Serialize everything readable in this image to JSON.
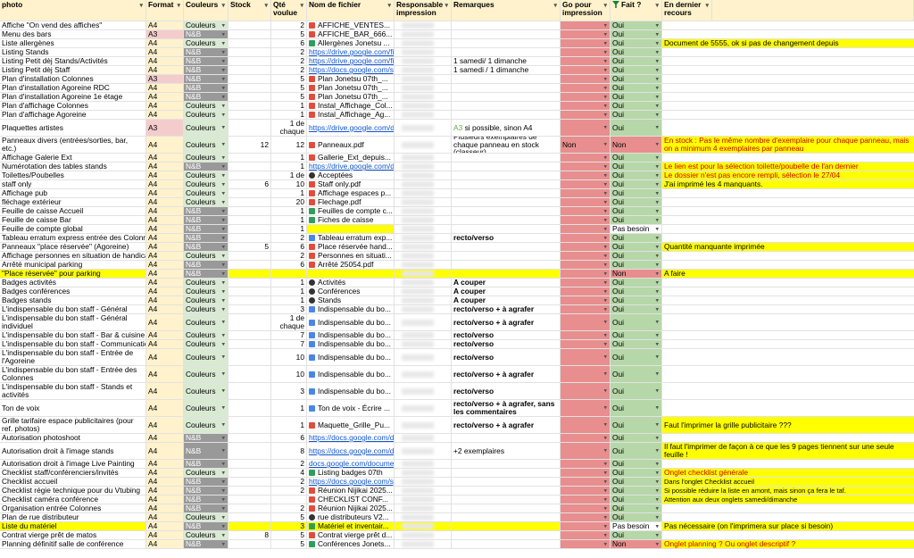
{
  "headers": [
    "photo",
    "Format",
    "Couleurs",
    "Stock",
    "Qté voulue",
    "Nom de fichier",
    "Responsable impression",
    "Remarques",
    "Go pour impression",
    "Fait ?",
    "En dernier recours",
    ""
  ],
  "colors": {
    "header": "#fff2cc",
    "format": "#fff2cc",
    "format_a3": "#f4cccc",
    "couleurs": "#d9ead3",
    "nb": "#999999",
    "go_red": "#e88e8e",
    "oui_green": "#b6d7a8",
    "non_red": "#e88e8e",
    "note_yellow": "#ffff00",
    "hilite_yellow": "#ffff00"
  },
  "rows": [
    {
      "photo": "Affiche \"On vend des affiches\"",
      "format": "A4",
      "couleurs": "Couleurs",
      "stock": "",
      "qte": "2",
      "file": "AFFICHE_VENTES...",
      "fileType": "pdf",
      "remark": "",
      "go": "",
      "fait": "Oui",
      "note": ""
    },
    {
      "photo": "Menu des bars",
      "format": "A3",
      "couleurs": "N&B",
      "stock": "",
      "qte": "5",
      "file": "AFFICHE_BAR_666...",
      "fileType": "pdf",
      "remark": "",
      "go": "",
      "fait": "Oui",
      "note": ""
    },
    {
      "photo": "Liste allergènes",
      "format": "A4",
      "couleurs": "Couleurs",
      "stock": "",
      "qte": "6",
      "file": "Allergènes Jonetsu ...",
      "fileType": "sheet",
      "remark": "",
      "go": "",
      "fait": "Oui",
      "note": "Document de 5555, ok si pas de changement depuis"
    },
    {
      "photo": "Listing Stands",
      "format": "A4",
      "couleurs": "N&B",
      "stock": "",
      "qte": "2",
      "file": "https://drive.google.com/file/d/",
      "fileType": "link",
      "remark": "",
      "go": "",
      "fait": "Oui",
      "note": ""
    },
    {
      "photo": "Listing Petit dèj Stands/Activités",
      "format": "A4",
      "couleurs": "N&B",
      "stock": "",
      "qte": "2",
      "file": "https://drive.google.com/file/d/",
      "fileType": "link",
      "remark": "1 samedi/ 1 dimanche",
      "go": "",
      "fait": "Oui",
      "note": ""
    },
    {
      "photo": "Listing Petit dèj Staff",
      "format": "A4",
      "couleurs": "N&B",
      "stock": "",
      "qte": "2",
      "file": "https://docs.google.com/spreads",
      "fileType": "link",
      "remark": "1 samedi / 1 dimanche",
      "go": "",
      "fait": "Oui",
      "note": ""
    },
    {
      "photo": "Plan d'installation Colonnes",
      "format": "A3",
      "couleurs": "N&B",
      "stock": "",
      "qte": "5",
      "file": "Plan Jonetsu 07th_...",
      "fileType": "pdf",
      "remark": "",
      "go": "",
      "fait": "Oui",
      "note": ""
    },
    {
      "photo": "Plan d'installation Agoreine RDC",
      "format": "A4",
      "couleurs": "N&B",
      "stock": "",
      "qte": "5",
      "file": "Plan Jonetsu 07th_...",
      "fileType": "pdf",
      "remark": "",
      "go": "",
      "fait": "Oui",
      "note": ""
    },
    {
      "photo": "Plan d'installation Agoreine 1e étage",
      "format": "A4",
      "couleurs": "N&B",
      "stock": "",
      "qte": "5",
      "file": "Plan Jonetsu 07th_...",
      "fileType": "pdf",
      "remark": "",
      "go": "",
      "fait": "Oui",
      "note": ""
    },
    {
      "photo": "Plan d'affichage Colonnes",
      "format": "A4",
      "couleurs": "Couleurs",
      "stock": "",
      "qte": "1",
      "file": "Instal_Affichage_Col...",
      "fileType": "pdf",
      "remark": "",
      "go": "",
      "fait": "Oui",
      "note": ""
    },
    {
      "photo": "Plan d'affichage Agoreine",
      "format": "A4",
      "couleurs": "Couleurs",
      "stock": "",
      "qte": "1",
      "file": "Instal_Affichage_Ag...",
      "fileType": "pdf",
      "remark": "",
      "go": "",
      "fait": "Oui",
      "note": ""
    },
    {
      "photo": "Plaquettes artistes",
      "format": "A3",
      "couleurs": "Couleurs",
      "stock": "",
      "qte": "1 de chaque",
      "file": "https://drive.google.com/drive/fo",
      "fileType": "link",
      "remark": "A3 si possible, sinon A4",
      "go": "",
      "fait": "Oui",
      "note": "",
      "tall": 2
    },
    {
      "photo": "Panneaux divers (entrées/sorties, bar, etc.)",
      "format": "A4",
      "couleurs": "Couleurs",
      "stock": "12",
      "qte": "12",
      "file": "Panneaux.pdf",
      "fileType": "pdf",
      "remark": "Plusieurs exemplaires de chaque panneau en stock (classeur)",
      "go": "Non",
      "fait": "Non",
      "note": "En stock : Pas le même nombre d'exemplaire pour chaque panneau, mais on a minimum 4 exemplaires par panneau",
      "tall": 2
    },
    {
      "photo": "Affichage Galerie Ext",
      "format": "A4",
      "couleurs": "Couleurs",
      "stock": "",
      "qte": "1",
      "file": "Gallerie_Ext_depuis...",
      "fileType": "pdf",
      "remark": "",
      "go": "",
      "fait": "Oui",
      "note": ""
    },
    {
      "photo": "Numérotation des tables stands",
      "format": "A4",
      "couleurs": "N&B",
      "stock": "",
      "qte": "1",
      "file": "https://drive.google.com/drive/fo",
      "fileType": "link",
      "remark": "",
      "go": "",
      "fait": "Oui",
      "note": "Le lien est pour la sélection toilette/poubelle de l'an dernier"
    },
    {
      "photo": "Toilettes/Poubelles",
      "format": "A4",
      "couleurs": "Couleurs",
      "stock": "",
      "qte": "1 de",
      "file": "Acceptées",
      "fileType": "img",
      "remark": "",
      "go": "",
      "fait": "Oui",
      "note": "Le dossier n'est pas encore rempli, sélection le 27/04"
    },
    {
      "photo": "staff only",
      "format": "A4",
      "couleurs": "Couleurs",
      "stock": "6",
      "qte": "10",
      "file": "Staff only.pdf",
      "fileType": "pdf",
      "remark": "",
      "go": "",
      "fait": "Oui",
      "note": "J'ai imprimé les 4 manquants."
    },
    {
      "photo": "Affichage pub",
      "format": "A4",
      "couleurs": "Couleurs",
      "stock": "",
      "qte": "1",
      "file": "Affichage espaces p...",
      "fileType": "pdf",
      "remark": "",
      "go": "",
      "fait": "Oui",
      "note": ""
    },
    {
      "photo": "fléchage extérieur",
      "format": "A4",
      "couleurs": "Couleurs",
      "stock": "",
      "qte": "20",
      "file": "Flechage.pdf",
      "fileType": "pdf",
      "remark": "",
      "go": "",
      "fait": "Oui",
      "note": ""
    },
    {
      "photo": "Feuille de caisse Accueil",
      "format": "A4",
      "couleurs": "N&B",
      "stock": "",
      "qte": "1",
      "file": "Feuilles de compte c...",
      "fileType": "sheet",
      "remark": "",
      "go": "",
      "fait": "Oui",
      "note": ""
    },
    {
      "photo": "Feuille de caisse Bar",
      "format": "A4",
      "couleurs": "N&B",
      "stock": "",
      "qte": "1",
      "file": "Fiches de caisse",
      "fileType": "sheet",
      "remark": "",
      "go": "",
      "fait": "Oui",
      "note": ""
    },
    {
      "photo": "Feuille de compte global",
      "format": "A4",
      "couleurs": "N&B",
      "stock": "",
      "qte": "1",
      "file": "",
      "fileType": "hilite",
      "remark": "",
      "go": "",
      "fait": "Pas besoin",
      "note": ""
    },
    {
      "photo": "Tableau erratum express entrée des Colonnes",
      "format": "A4",
      "couleurs": "N&B",
      "stock": "",
      "qte": "2",
      "file": "Tableau erratum exp...",
      "fileType": "doc",
      "remark": "recto/verso",
      "go": "",
      "fait": "Oui",
      "note": ""
    },
    {
      "photo": "Panneaux \"place réservée\" (Agoreine)",
      "format": "A4",
      "couleurs": "N&B",
      "stock": "5",
      "qte": "6",
      "file": "Place réservée hand...",
      "fileType": "pdf",
      "remark": "",
      "go": "",
      "fait": "Oui",
      "note": "Quantité manquante imprimée"
    },
    {
      "photo": "Affichage personnes en situation de handicap",
      "format": "A4",
      "couleurs": "Couleurs",
      "stock": "",
      "qte": "2",
      "file": "Personnes en situati...",
      "fileType": "pdf",
      "remark": "",
      "go": "",
      "fait": "Oui",
      "note": ""
    },
    {
      "photo": "Arrêté municipal parking",
      "format": "A4",
      "couleurs": "N&B",
      "stock": "",
      "qte": "6",
      "file": "Arrêté 25054.pdf",
      "fileType": "pdf",
      "remark": "",
      "go": "",
      "fait": "Oui",
      "note": ""
    },
    {
      "photo": "\"Place réservée\" pour parking",
      "format": "A4",
      "couleurs": "N&B",
      "stock": "",
      "qte": "",
      "file": "",
      "fileType": "hilite",
      "remark": "",
      "go": "",
      "fait": "Non",
      "note": "A faire",
      "rowHilite": true
    },
    {
      "photo": "Badges activités",
      "format": "A4",
      "couleurs": "Couleurs",
      "stock": "",
      "qte": "1",
      "file": "Activités",
      "fileType": "img",
      "remark": "A couper",
      "go": "",
      "fait": "Oui",
      "note": ""
    },
    {
      "photo": "Badges conférences",
      "format": "A4",
      "couleurs": "Couleurs",
      "stock": "",
      "qte": "1",
      "file": "Conférences",
      "fileType": "img",
      "remark": "A couper",
      "go": "",
      "fait": "Oui",
      "note": ""
    },
    {
      "photo": "Badges stands",
      "format": "A4",
      "couleurs": "Couleurs",
      "stock": "",
      "qte": "1",
      "file": "Stands",
      "fileType": "img",
      "remark": "A couper",
      "go": "",
      "fait": "Oui",
      "note": ""
    },
    {
      "photo": "L'indispensable du bon staff - Général",
      "format": "A4",
      "couleurs": "Couleurs",
      "stock": "",
      "qte": "3",
      "file": "Indispensable du bo...",
      "fileType": "doc",
      "remark": "recto/verso + à agrafer",
      "go": "",
      "fait": "Oui",
      "note": ""
    },
    {
      "photo": "L'indispensable du bon staff - Général individuel",
      "format": "A4",
      "couleurs": "Couleurs",
      "stock": "",
      "qte": "1 de chaque",
      "file": "Indispensable du bo...",
      "fileType": "doc",
      "remark": "recto/verso + à agrafer",
      "go": "",
      "fait": "Oui",
      "note": "",
      "tall": 2
    },
    {
      "photo": "L'indispensable du bon staff - Bar & cuisine",
      "format": "A4",
      "couleurs": "Couleurs",
      "stock": "",
      "qte": "7",
      "file": "Indispensable du bo...",
      "fileType": "doc",
      "remark": "recto/verso",
      "go": "",
      "fait": "Oui",
      "note": ""
    },
    {
      "photo": "L'indispensable du bon staff - Communication",
      "format": "A4",
      "couleurs": "Couleurs",
      "stock": "",
      "qte": "7",
      "file": "Indispensable du bo...",
      "fileType": "doc",
      "remark": "recto/verso",
      "go": "",
      "fait": "Oui",
      "note": ""
    },
    {
      "photo": "L'indispensable du bon staff - Entrée de l'Agoreine",
      "format": "A4",
      "couleurs": "Couleurs",
      "stock": "",
      "qte": "10",
      "file": "Indispensable du bo...",
      "fileType": "doc",
      "remark": "recto/verso",
      "go": "",
      "fait": "Oui",
      "note": "",
      "tall": 2
    },
    {
      "photo": "L'indispensable du bon staff - Entrée des Colonnes",
      "format": "A4",
      "couleurs": "Couleurs",
      "stock": "",
      "qte": "10",
      "file": "Indispensable du bo...",
      "fileType": "doc",
      "remark": "recto/verso + à agrafer",
      "go": "",
      "fait": "Oui",
      "note": "",
      "tall": 2
    },
    {
      "photo": "L'indispensable du bon staff - Stands et activités",
      "format": "A4",
      "couleurs": "Couleurs",
      "stock": "",
      "qte": "3",
      "file": "Indispensable du bo...",
      "fileType": "doc",
      "remark": "recto/verso",
      "go": "",
      "fait": "Oui",
      "note": "",
      "tall": 2
    },
    {
      "photo": "Ton de voix",
      "format": "A4",
      "couleurs": "Couleurs",
      "stock": "",
      "qte": "1",
      "file": "Ton de voix - Écrire ...",
      "fileType": "doc",
      "remark": "recto/verso + à agrafer, sans les commentaires",
      "go": "",
      "fait": "Oui",
      "note": "",
      "tall": 2
    },
    {
      "photo": "Grille tarifaire espace publicitaires (pour ref. photos)",
      "format": "A4",
      "couleurs": "Couleurs",
      "stock": "",
      "qte": "1",
      "file": "Maquette_Grille_Pu...",
      "fileType": "pdf",
      "remark": "recto/verso + à agrafer",
      "go": "",
      "fait": "Oui",
      "note": "Faut l'imprimer la grille publicitaire ???",
      "tall": 2
    },
    {
      "photo": "Autorisation photoshoot",
      "format": "A4",
      "couleurs": "N&B",
      "stock": "",
      "qte": "6",
      "file": "https://docs.google.com/docume",
      "fileType": "link",
      "remark": "",
      "go": "",
      "fait": "Oui",
      "note": ""
    },
    {
      "photo": "Autorisation droit à l'image stands",
      "format": "A4",
      "couleurs": "N&B",
      "stock": "",
      "qte": "8",
      "file": "https://docs.google.com/docume",
      "fileType": "link",
      "remark": "+2 exemplaires",
      "go": "",
      "fait": "Oui",
      "note": "Il faut l'imprimer de façon à ce que les 9 pages tiennent sur une seule feuille !",
      "tall": 2
    },
    {
      "photo": "Autorisation droit à l'image Live Painting",
      "format": "A4",
      "couleurs": "N&B",
      "stock": "",
      "qte": "2",
      "file": "docs.google.com/document/d/",
      "fileType": "link",
      "remark": "",
      "go": "",
      "fait": "Oui",
      "note": ""
    },
    {
      "photo": "Checklist staff/conférenciers/invités",
      "format": "A4",
      "couleurs": "Couleurs",
      "stock": "",
      "qte": "4",
      "file": "Listing badges 07th",
      "fileType": "sheet",
      "remark": "",
      "go": "",
      "fait": "Oui",
      "note": "Onglet checklist générale"
    },
    {
      "photo": "Checklist accueil",
      "format": "A4",
      "couleurs": "N&B",
      "stock": "",
      "qte": "2",
      "file": "https://docs.google.com/spreads",
      "fileType": "link",
      "remark": "",
      "go": "",
      "fait": "Oui",
      "note": "Dans l'onglet Checklist accueil"
    },
    {
      "photo": "Checklist régie technique pour du Vtubing",
      "format": "A4",
      "couleurs": "N&B",
      "stock": "",
      "qte": "2",
      "file": "Réunion Nijikai 2025...",
      "fileType": "pdf",
      "remark": "",
      "go": "",
      "fait": "Oui",
      "note": "Si possible réduire la liste en amont, mais sinon ça fera le taf."
    },
    {
      "photo": "Checklist caméra conférence",
      "format": "A4",
      "couleurs": "N&B",
      "stock": "",
      "qte": "",
      "file": "CHECKLIST CONF...",
      "fileType": "pdf",
      "remark": "",
      "go": "",
      "fait": "Oui",
      "note": "Attention aux deux onglets samedi/dimanche"
    },
    {
      "photo": "Organisation entrée Colonnes",
      "format": "A4",
      "couleurs": "N&B",
      "stock": "",
      "qte": "2",
      "file": "Réunion Nijikai 2025...",
      "fileType": "pdf",
      "remark": "",
      "go": "",
      "fait": "Oui",
      "note": ""
    },
    {
      "photo": "Plan de rue distributeur",
      "format": "A4",
      "couleurs": "Couleurs",
      "stock": "",
      "qte": "5",
      "file": "rue distributeurs V2...",
      "fileType": "img",
      "remark": "",
      "go": "",
      "fait": "Oui",
      "note": ""
    },
    {
      "photo": "Liste du matériel",
      "format": "A4",
      "couleurs": "N&B",
      "stock": "",
      "qte": "3",
      "file": "Matériel et inventair...",
      "fileType": "sheet",
      "remark": "",
      "go": "",
      "fait": "Pas besoin",
      "note": "Pas nécessaire (on l'imprimera sur place si besoin)",
      "rowHilite": true
    },
    {
      "photo": "Contrat vierge prêt de matos",
      "format": "A4",
      "couleurs": "Couleurs",
      "stock": "8",
      "qte": "5",
      "file": "Contrat vierge prêt d...",
      "fileType": "pdf",
      "remark": "",
      "go": "",
      "fait": "Oui",
      "note": ""
    },
    {
      "photo": "Planning définitif salle de conférence",
      "format": "A4",
      "couleurs": "N&B",
      "stock": "",
      "qte": "5",
      "file": "Conférences Jonets...",
      "fileType": "sheet",
      "remark": "",
      "go": "",
      "fait": "Non",
      "note": "Onglet planning ? Ou onglet descriptif ?"
    }
  ]
}
